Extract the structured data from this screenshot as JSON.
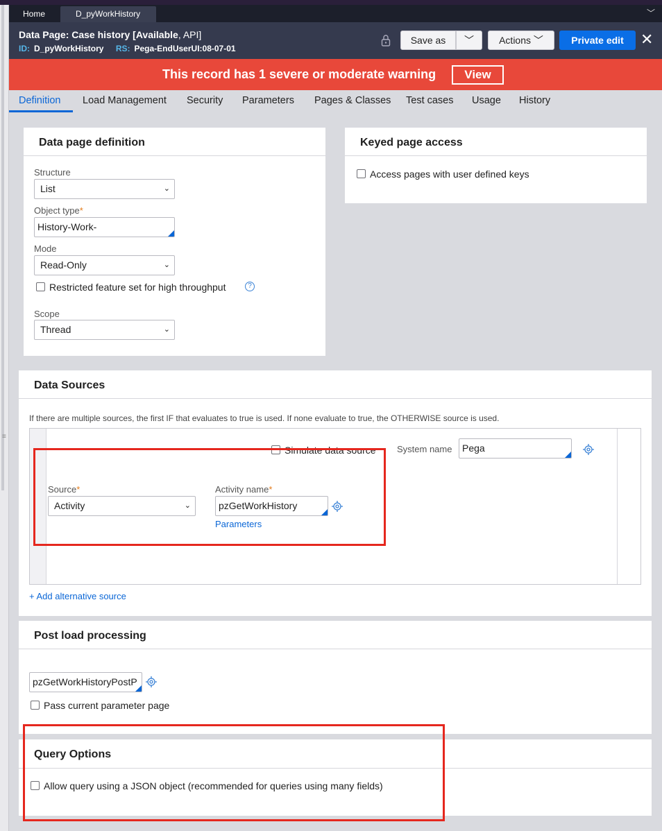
{
  "tabs": {
    "home": "Home",
    "active": "D_pyWorkHistory"
  },
  "header": {
    "title_prefix": "Data Page: Case history [",
    "title_status": "Available",
    "title_api": ", API]",
    "id_label": "ID:",
    "id_value": "D_pyWorkHistory",
    "rs_label": "RS:",
    "rs_value": "Pega-EndUserUI:08-07-01",
    "save_as": "Save as",
    "actions": "Actions",
    "private_edit": "Private edit"
  },
  "warning": {
    "text": "This record has 1 severe or moderate warning",
    "view": "View"
  },
  "nav": [
    "Definition",
    "Load Management",
    "Security",
    "Parameters",
    "Pages & Classes",
    "Test cases",
    "Usage",
    "History"
  ],
  "definition": {
    "title": "Data page definition",
    "structure_label": "Structure",
    "structure_value": "List",
    "object_type_label": "Object type",
    "object_type_value": "History-Work-",
    "mode_label": "Mode",
    "mode_value": "Read-Only",
    "restricted_label": "Restricted feature set for high throughput",
    "scope_label": "Scope",
    "scope_value": "Thread"
  },
  "keyed": {
    "title": "Keyed page access",
    "checkbox_label": "Access pages with user defined keys"
  },
  "sources": {
    "title": "Data Sources",
    "note": "If there are multiple sources, the first IF that evaluates to true is used. If none evaluate to true, the OTHERWISE source is used.",
    "simulate_label": "Simulate data source",
    "system_name_label": "System name",
    "system_name_value": "Pega",
    "source_label": "Source",
    "source_value": "Activity",
    "activity_label": "Activity name",
    "activity_value": "pzGetWorkHistory",
    "parameters_link": "Parameters",
    "add_alt": "+ Add alternative source"
  },
  "postload": {
    "title": "Post load processing",
    "activity_value": "pzGetWorkHistoryPostP",
    "pass_param_label": "Pass current parameter page"
  },
  "query": {
    "title": "Query Options",
    "json_label": "Allow query using a JSON object (recommended for queries using many fields)"
  },
  "colors": {
    "accent": "#0a66d6",
    "warning_bg": "#e8483a",
    "header_bg": "#353a4e",
    "highlight": "#e5271e"
  }
}
